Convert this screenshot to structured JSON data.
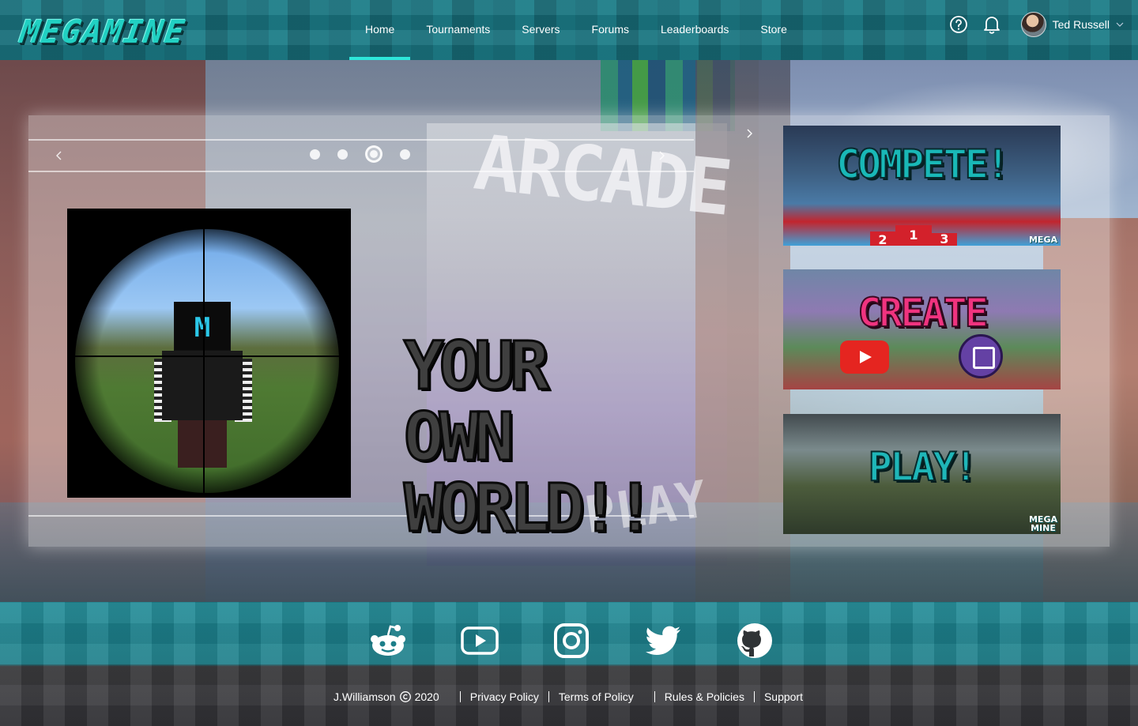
{
  "header": {
    "logo_text": "MEGAMINE",
    "nav": [
      {
        "label": "Home",
        "active": true
      },
      {
        "label": "Tournaments"
      },
      {
        "label": "Servers"
      },
      {
        "label": "Forums"
      },
      {
        "label": "Leaderboards"
      },
      {
        "label": "Store"
      }
    ],
    "help_icon": "question-circle-icon",
    "notification_icon": "bell-icon",
    "user_name": "Ted Russell",
    "accent_color": "#2ee6da"
  },
  "hero": {
    "background_words": {
      "arcade": "ARCADE",
      "play": "PLAY"
    },
    "carousel": {
      "dot_count": 4,
      "active_dot": 3,
      "slide_text": [
        "YOUR",
        "OWN",
        "WORLD!!"
      ],
      "slide_image_letter": "M"
    },
    "banners": {
      "compete": {
        "title": "COMPETE!",
        "podium": [
          "2",
          "1",
          "3"
        ],
        "tag": "MEGA"
      },
      "create": {
        "title": "CREATE"
      },
      "play": {
        "title": "PLAY!",
        "tag_line1": "MEGA",
        "tag_line2": "MINE"
      }
    }
  },
  "footer": {
    "socials": [
      "reddit-icon",
      "youtube-icon",
      "instagram-icon",
      "twitter-icon",
      "github-icon"
    ],
    "author": "J.Williamson",
    "year": "2020",
    "links": [
      "Privacy Policy",
      "Terms of Policy",
      "Rules & Policies",
      "Support"
    ]
  }
}
